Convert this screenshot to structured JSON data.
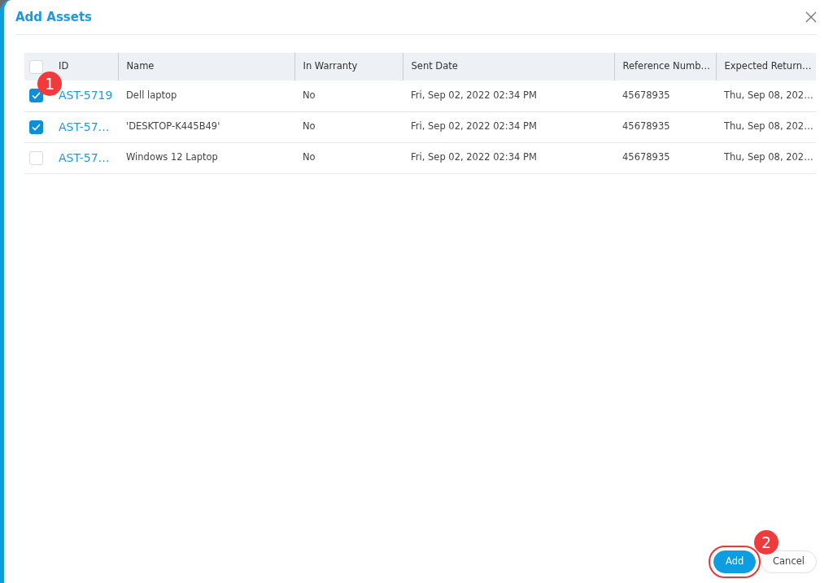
{
  "dialog": {
    "title": "Add Assets"
  },
  "table": {
    "select_all": {
      "checked": false
    },
    "columns": [
      "ID",
      "Name",
      "In Warranty",
      "Sent Date",
      "Reference Numb…",
      "Expected Return…"
    ],
    "rows": [
      {
        "selected": true,
        "cells": [
          "AST-5719",
          "Dell laptop",
          "No",
          "Fri, Sep 02, 2022 02:34 PM",
          "45678935",
          "Thu, Sep 08, 202…"
        ]
      },
      {
        "selected": true,
        "cells": [
          "AST-57…",
          "'DESKTOP-K445B49'",
          "No",
          "Fri, Sep 02, 2022 02:34 PM",
          "45678935",
          "Thu, Sep 08, 202…"
        ]
      },
      {
        "selected": false,
        "cells": [
          "AST-57…",
          "Windows 12 Laptop",
          "No",
          "Fri, Sep 02, 2022 02:34 PM",
          "45678935",
          "Thu, Sep 08, 202…"
        ]
      }
    ]
  },
  "callouts": [
    "1",
    "2"
  ],
  "buttons": [
    {
      "kind": "primary",
      "label": "Add",
      "highlighted": true
    },
    {
      "kind": "secondary",
      "label": "Cancel",
      "highlighted": false
    }
  ]
}
